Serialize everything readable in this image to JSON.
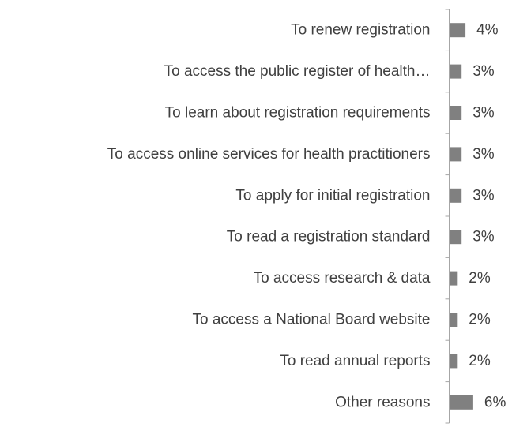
{
  "chart_data": {
    "type": "bar",
    "orientation": "horizontal",
    "categories": [
      "To renew registration",
      "To access the public register of health…",
      "To learn about registration requirements",
      "To access online services for health practitioners",
      "To apply for initial registration",
      "To read a registration standard",
      "To access research & data",
      "To access a National Board website",
      "To read annual reports",
      "Other reasons"
    ],
    "values": [
      4,
      3,
      3,
      3,
      3,
      3,
      2,
      2,
      2,
      6
    ],
    "value_labels": [
      "4%",
      "3%",
      "3%",
      "3%",
      "3%",
      "3%",
      "2%",
      "2%",
      "2%",
      "6%"
    ],
    "xlim": [
      0,
      30
    ],
    "bar_color": "#808080",
    "axis_color": "#a6a6a6",
    "grid": false,
    "legend": "none"
  }
}
